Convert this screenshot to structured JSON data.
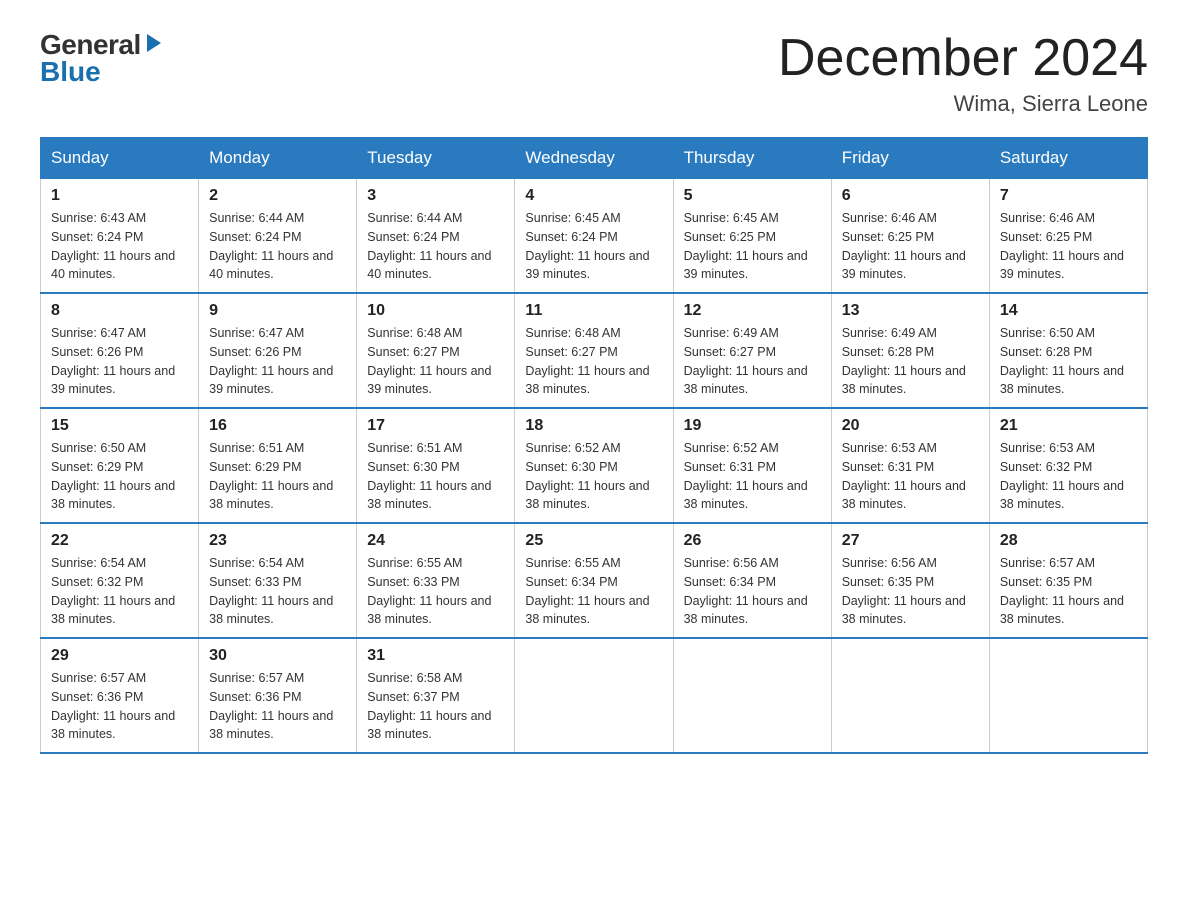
{
  "logo": {
    "general": "General",
    "blue": "Blue",
    "arrow": "▶"
  },
  "title": "December 2024",
  "location": "Wima, Sierra Leone",
  "days_of_week": [
    "Sunday",
    "Monday",
    "Tuesday",
    "Wednesday",
    "Thursday",
    "Friday",
    "Saturday"
  ],
  "weeks": [
    [
      {
        "day": "1",
        "sunrise": "6:43 AM",
        "sunset": "6:24 PM",
        "daylight": "11 hours and 40 minutes."
      },
      {
        "day": "2",
        "sunrise": "6:44 AM",
        "sunset": "6:24 PM",
        "daylight": "11 hours and 40 minutes."
      },
      {
        "day": "3",
        "sunrise": "6:44 AM",
        "sunset": "6:24 PM",
        "daylight": "11 hours and 40 minutes."
      },
      {
        "day": "4",
        "sunrise": "6:45 AM",
        "sunset": "6:24 PM",
        "daylight": "11 hours and 39 minutes."
      },
      {
        "day": "5",
        "sunrise": "6:45 AM",
        "sunset": "6:25 PM",
        "daylight": "11 hours and 39 minutes."
      },
      {
        "day": "6",
        "sunrise": "6:46 AM",
        "sunset": "6:25 PM",
        "daylight": "11 hours and 39 minutes."
      },
      {
        "day": "7",
        "sunrise": "6:46 AM",
        "sunset": "6:25 PM",
        "daylight": "11 hours and 39 minutes."
      }
    ],
    [
      {
        "day": "8",
        "sunrise": "6:47 AM",
        "sunset": "6:26 PM",
        "daylight": "11 hours and 39 minutes."
      },
      {
        "day": "9",
        "sunrise": "6:47 AM",
        "sunset": "6:26 PM",
        "daylight": "11 hours and 39 minutes."
      },
      {
        "day": "10",
        "sunrise": "6:48 AM",
        "sunset": "6:27 PM",
        "daylight": "11 hours and 39 minutes."
      },
      {
        "day": "11",
        "sunrise": "6:48 AM",
        "sunset": "6:27 PM",
        "daylight": "11 hours and 38 minutes."
      },
      {
        "day": "12",
        "sunrise": "6:49 AM",
        "sunset": "6:27 PM",
        "daylight": "11 hours and 38 minutes."
      },
      {
        "day": "13",
        "sunrise": "6:49 AM",
        "sunset": "6:28 PM",
        "daylight": "11 hours and 38 minutes."
      },
      {
        "day": "14",
        "sunrise": "6:50 AM",
        "sunset": "6:28 PM",
        "daylight": "11 hours and 38 minutes."
      }
    ],
    [
      {
        "day": "15",
        "sunrise": "6:50 AM",
        "sunset": "6:29 PM",
        "daylight": "11 hours and 38 minutes."
      },
      {
        "day": "16",
        "sunrise": "6:51 AM",
        "sunset": "6:29 PM",
        "daylight": "11 hours and 38 minutes."
      },
      {
        "day": "17",
        "sunrise": "6:51 AM",
        "sunset": "6:30 PM",
        "daylight": "11 hours and 38 minutes."
      },
      {
        "day": "18",
        "sunrise": "6:52 AM",
        "sunset": "6:30 PM",
        "daylight": "11 hours and 38 minutes."
      },
      {
        "day": "19",
        "sunrise": "6:52 AM",
        "sunset": "6:31 PM",
        "daylight": "11 hours and 38 minutes."
      },
      {
        "day": "20",
        "sunrise": "6:53 AM",
        "sunset": "6:31 PM",
        "daylight": "11 hours and 38 minutes."
      },
      {
        "day": "21",
        "sunrise": "6:53 AM",
        "sunset": "6:32 PM",
        "daylight": "11 hours and 38 minutes."
      }
    ],
    [
      {
        "day": "22",
        "sunrise": "6:54 AM",
        "sunset": "6:32 PM",
        "daylight": "11 hours and 38 minutes."
      },
      {
        "day": "23",
        "sunrise": "6:54 AM",
        "sunset": "6:33 PM",
        "daylight": "11 hours and 38 minutes."
      },
      {
        "day": "24",
        "sunrise": "6:55 AM",
        "sunset": "6:33 PM",
        "daylight": "11 hours and 38 minutes."
      },
      {
        "day": "25",
        "sunrise": "6:55 AM",
        "sunset": "6:34 PM",
        "daylight": "11 hours and 38 minutes."
      },
      {
        "day": "26",
        "sunrise": "6:56 AM",
        "sunset": "6:34 PM",
        "daylight": "11 hours and 38 minutes."
      },
      {
        "day": "27",
        "sunrise": "6:56 AM",
        "sunset": "6:35 PM",
        "daylight": "11 hours and 38 minutes."
      },
      {
        "day": "28",
        "sunrise": "6:57 AM",
        "sunset": "6:35 PM",
        "daylight": "11 hours and 38 minutes."
      }
    ],
    [
      {
        "day": "29",
        "sunrise": "6:57 AM",
        "sunset": "6:36 PM",
        "daylight": "11 hours and 38 minutes."
      },
      {
        "day": "30",
        "sunrise": "6:57 AM",
        "sunset": "6:36 PM",
        "daylight": "11 hours and 38 minutes."
      },
      {
        "day": "31",
        "sunrise": "6:58 AM",
        "sunset": "6:37 PM",
        "daylight": "11 hours and 38 minutes."
      },
      null,
      null,
      null,
      null
    ]
  ]
}
